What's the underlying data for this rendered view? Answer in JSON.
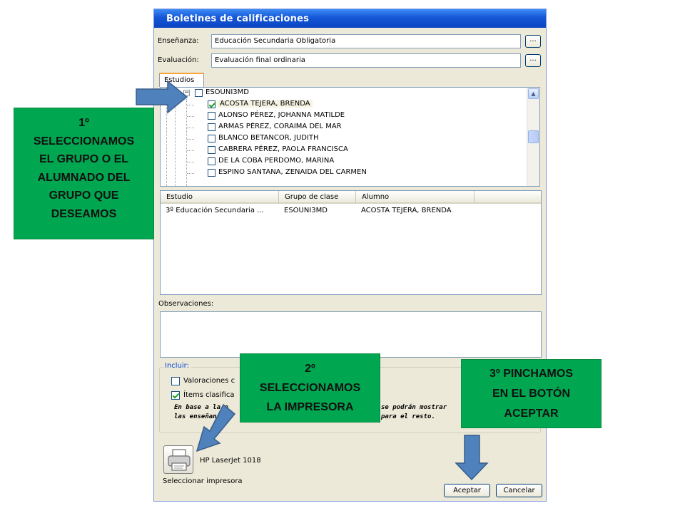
{
  "dialog": {
    "title": "Boletines de calificaciones",
    "ensenanza_label": "Enseñanza:",
    "ensenanza_value": "Educación Secundaria Obligatoria",
    "evaluacion_label": "Evaluación:",
    "evaluacion_value": "Evaluación final ordinaria",
    "browse_label": "...",
    "tab_label": "Estudios",
    "tree": {
      "group": "ESOUNI3MD",
      "students": [
        {
          "name": "ACOSTA TEJERA, BRENDA",
          "checked": true
        },
        {
          "name": "ALONSO PÉREZ, JOHANNA MATILDE",
          "checked": false
        },
        {
          "name": "ARMAS PÉREZ, CORAIMA DEL MAR",
          "checked": false
        },
        {
          "name": "BLANCO BETANCOR, JUDITH",
          "checked": false
        },
        {
          "name": "CABRERA PÉREZ, PAOLA FRANCISCA",
          "checked": false
        },
        {
          "name": "DE LA COBA PERDOMO, MARINA",
          "checked": false
        },
        {
          "name": "ESPINO SANTANA, ZENAIDA DEL CARMEN",
          "checked": false
        }
      ]
    },
    "grid": {
      "columns": [
        "Estudio",
        "Grupo de clase",
        "Alumno"
      ],
      "rows": [
        [
          "3º Educación Secundaria ...",
          "ESOUNI3MD",
          "ACOSTA TEJERA, BRENDA"
        ]
      ]
    },
    "observaciones_label": "Observaciones:",
    "incluir": {
      "legend": "Incluir:",
      "valoraciones_label": "Valoraciones c",
      "valoraciones_checked": false,
      "items_label": "Ítems clasifica",
      "items_checked": true,
      "note_line1_left": "En base a la e",
      "note_line1_right": "se podrán mostrar",
      "note_line2_left": "las enseñanzas",
      "note_line2_right": "para el resto."
    },
    "printer_name": "HP LaserJet 1018",
    "select_printer_label": "Seleccionar impresora",
    "accept_label": "Aceptar",
    "cancel_label": "Cancelar"
  },
  "annotations": {
    "step1": [
      "1º",
      "SELECCIONAMOS",
      "EL GRUPO O EL",
      "ALUMNADO DEL",
      "GRUPO QUE",
      "DESEAMOS"
    ],
    "step2": [
      "2º",
      "SELECCIONAMOS",
      "LA IMPRESORA"
    ],
    "step3": [
      "3º PINCHAMOS",
      "EN EL BOTÓN",
      "ACEPTAR"
    ],
    "note_color": "#00a650",
    "arrow_color": "#4f81bd"
  }
}
